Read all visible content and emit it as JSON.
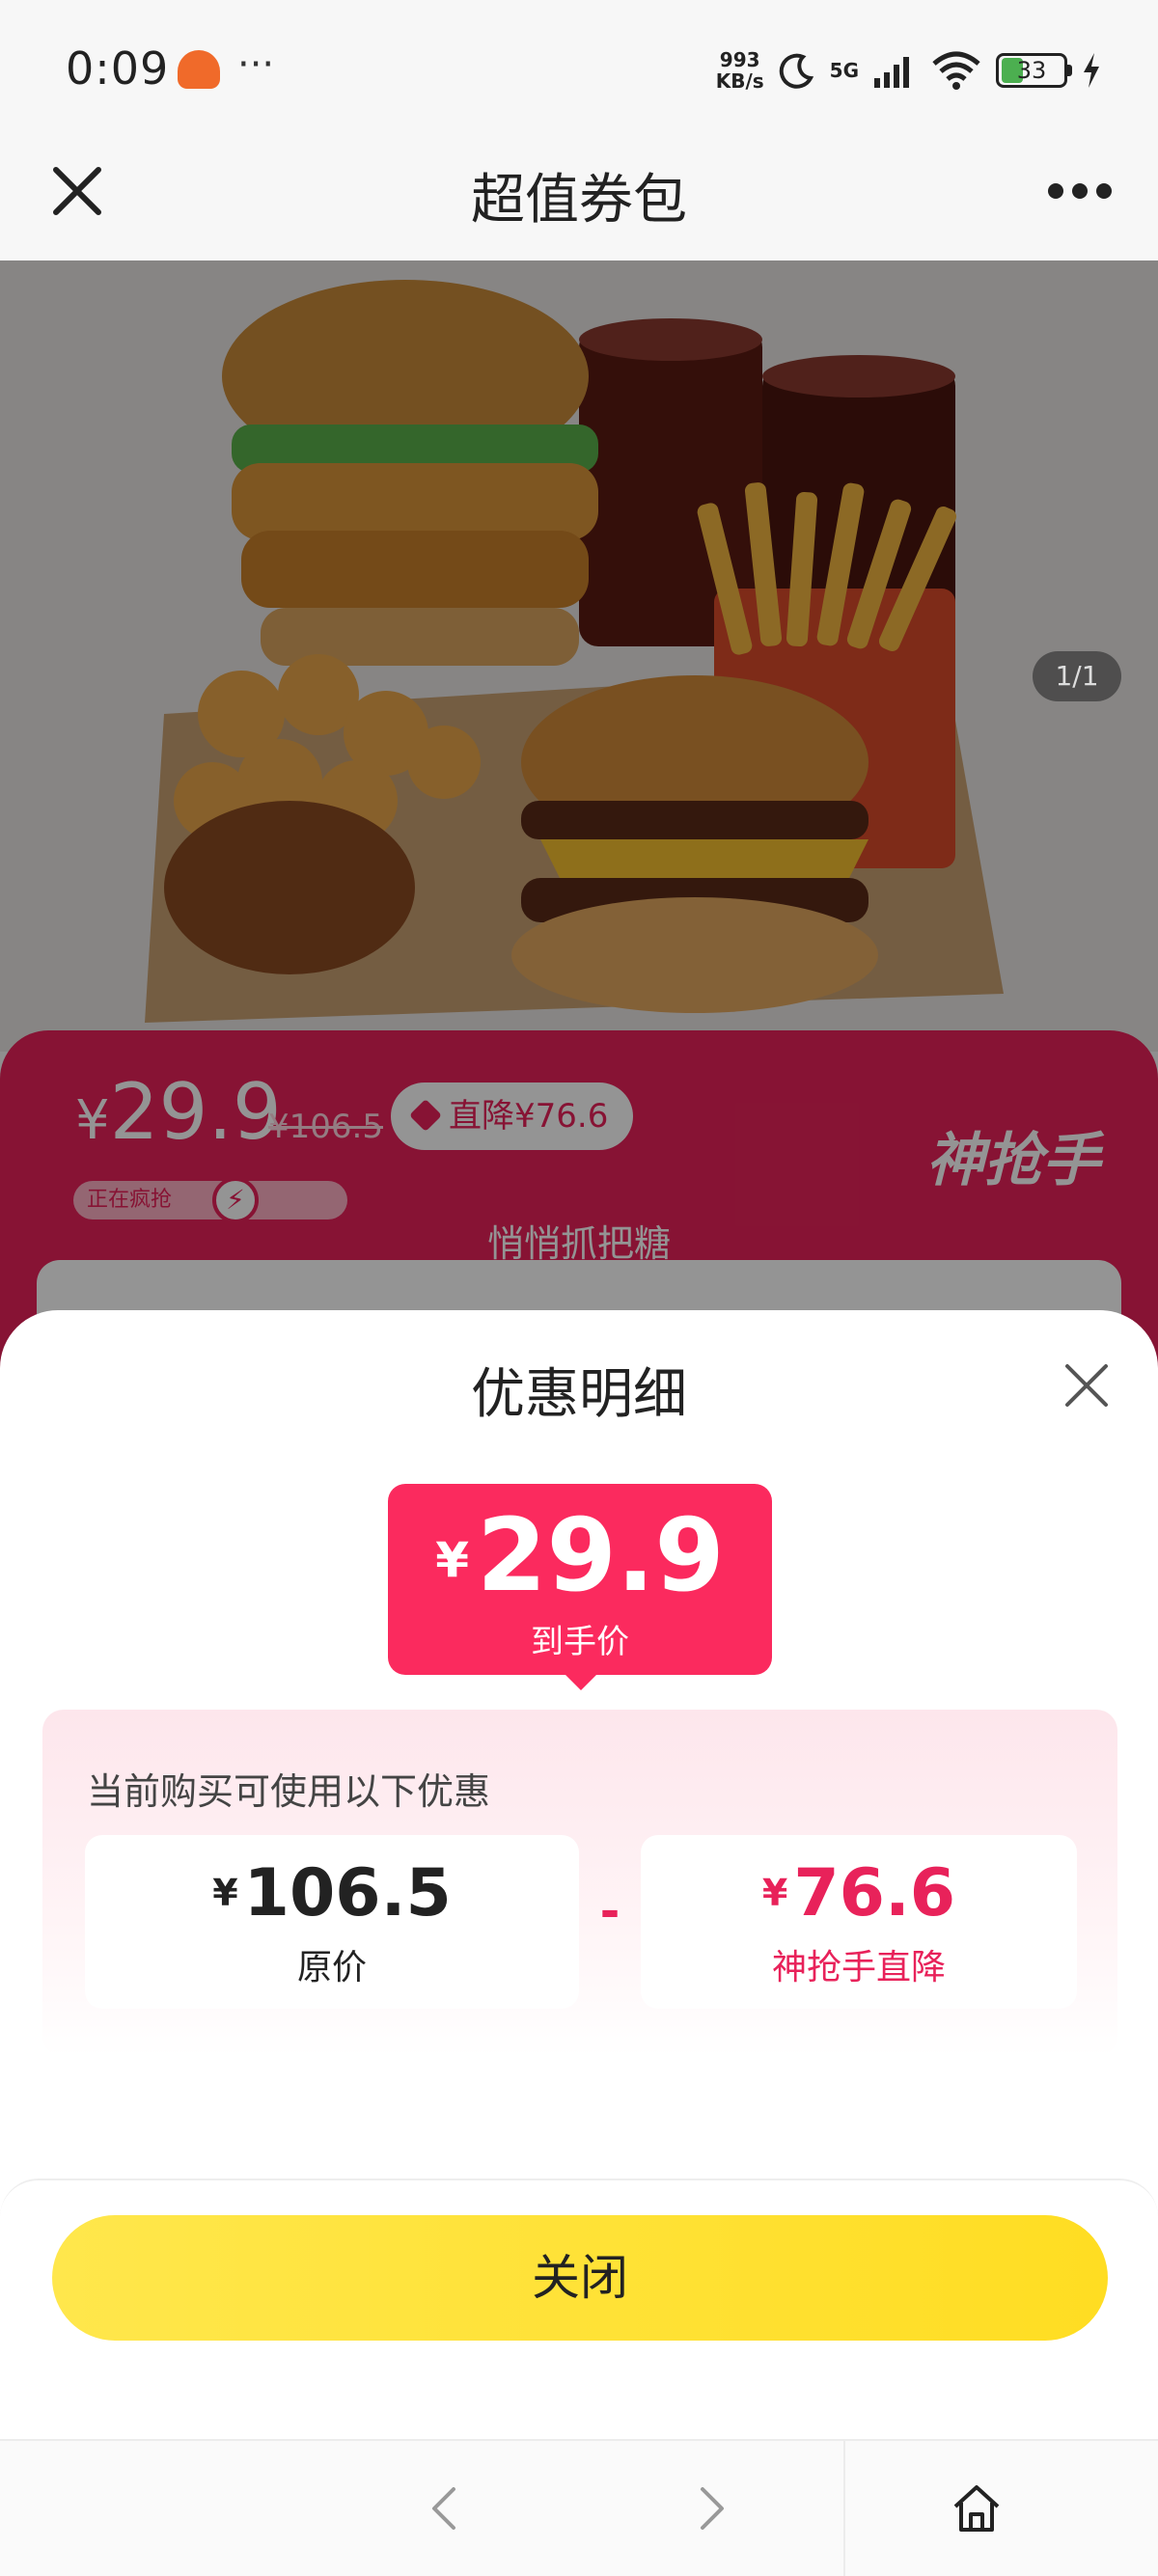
{
  "status_bar": {
    "time": "0:09",
    "more": "···",
    "speed_value": "993",
    "speed_unit": "KB/s",
    "network": "5G",
    "battery": "33"
  },
  "nav": {
    "title": "超值券包"
  },
  "product": {
    "image_counter": "1/1"
  },
  "price_band": {
    "price_symbol": "¥",
    "price": "29.9",
    "original_price": "¥106.5",
    "drop_badge": "直降¥76.6",
    "status": "正在疯抢",
    "brand": "神抢手",
    "marquee": "悄悄抓把糖"
  },
  "sheet": {
    "title": "优惠明细",
    "final_symbol": "¥",
    "final_price": "29.9",
    "final_label": "到手价",
    "caption": "当前购买可使用以下优惠",
    "original": {
      "symbol": "¥",
      "amount": "106.5",
      "label": "原价"
    },
    "operator": "-",
    "discount": {
      "symbol": "¥",
      "amount": "76.6",
      "label": "神抢手直降"
    },
    "close_button": "关闭"
  },
  "colors": {
    "accent": "#fb2a5e",
    "band": "#e8225a",
    "button": "#ffdd22"
  }
}
